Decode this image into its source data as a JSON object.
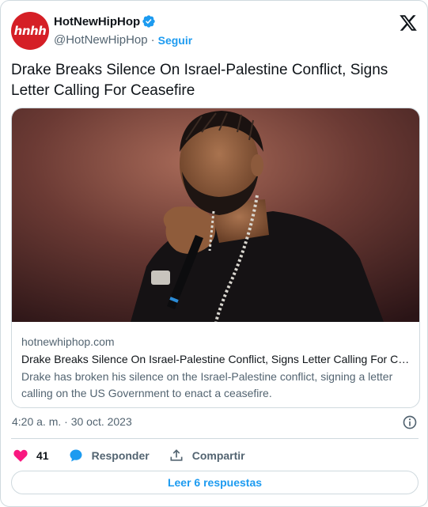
{
  "account": {
    "avatar_text": "hnhh",
    "name": "HotNewHipHop",
    "handle": "@HotNewHipHop",
    "separator": "·",
    "follow_label": "Seguir"
  },
  "tweet": {
    "text": "Drake Breaks Silence On Israel-Palestine Conflict, Signs Letter Calling For Ceasefire",
    "timestamp": "4:20 a. m. · 30 oct. 2023"
  },
  "link_card": {
    "domain": "hotnewhiphop.com",
    "title": "Drake Breaks Silence On Israel-Palestine Conflict, Signs Letter Calling For Ceasefire",
    "description": "Drake has broken his silence on the Israel-Palestine conflict, signing a letter calling on the US Government to enact a ceasefire."
  },
  "actions": {
    "like_count": "41",
    "reply_label": "Responder",
    "share_label": "Compartir"
  },
  "read_replies_label": "Leer 6 respuestas",
  "colors": {
    "accent": "#1d9bf0",
    "heart": "#f91880",
    "brand_red": "#d51f26",
    "muted": "#536471"
  }
}
